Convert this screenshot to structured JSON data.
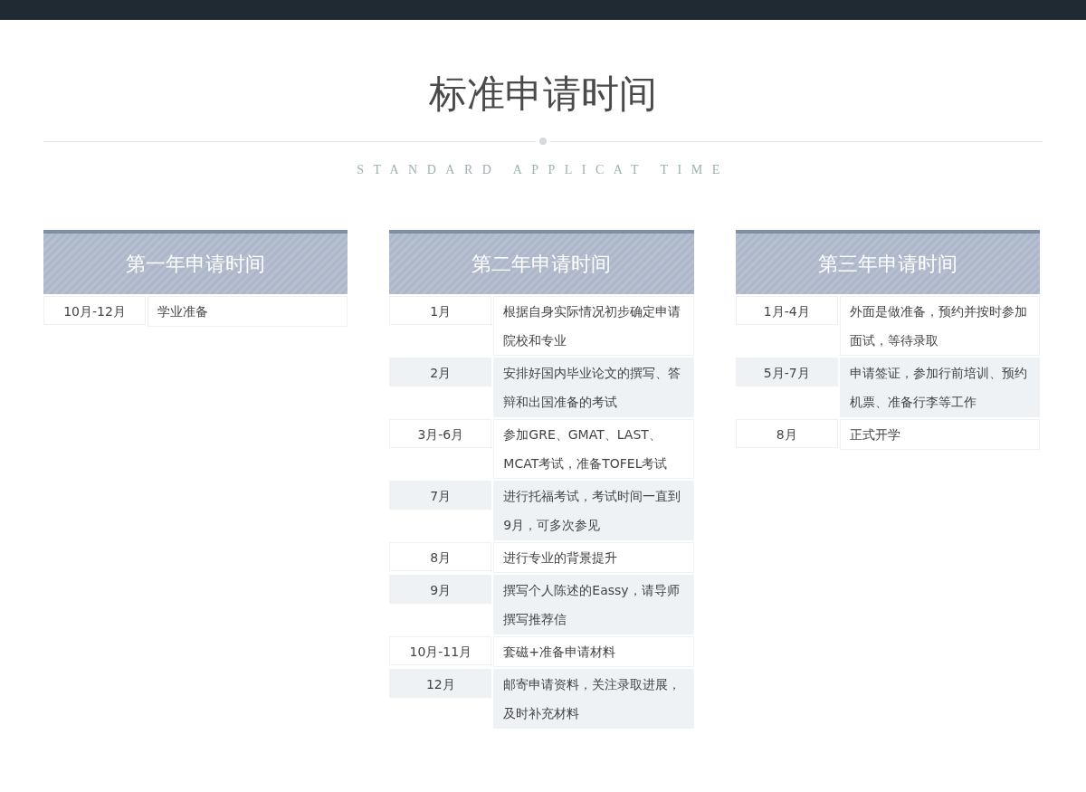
{
  "title": "标准申请时间",
  "subtitle": "STANDARD APPLICAT TIME",
  "columns": [
    {
      "heading": "第一年申请时间",
      "rows": [
        {
          "month": "10月-12月",
          "task": "学业准备"
        }
      ]
    },
    {
      "heading": "第二年申请时间",
      "rows": [
        {
          "month": "1月",
          "task": "根据自身实际情况初步确定申请院校和专业"
        },
        {
          "month": "2月",
          "task": "安排好国内毕业论文的撰写、答辩和出国准备的考试"
        },
        {
          "month": "3月-6月",
          "task": "参加GRE、GMAT、LAST、MCAT考试，准备TOFEL考试"
        },
        {
          "month": "7月",
          "task": "进行托福考试，考试时间一直到9月，可多次参见"
        },
        {
          "month": "8月",
          "task": "进行专业的背景提升"
        },
        {
          "month": "9月",
          "task": "撰写个人陈述的Eassy，请导师撰写推荐信"
        },
        {
          "month": "10月-11月",
          "task": "套磁+准备申请材料"
        },
        {
          "month": "12月",
          "task": "邮寄申请资料，关注录取进展，及时补充材料"
        }
      ]
    },
    {
      "heading": "第三年申请时间",
      "rows": [
        {
          "month": "1月-4月",
          "task": "外面是做准备，预约并按时参加面试，等待录取"
        },
        {
          "month": "5月-7月",
          "task": "申请签证，参加行前培训、预约机票、准备行李等工作"
        },
        {
          "month": "8月",
          "task": "正式开学"
        }
      ]
    }
  ]
}
